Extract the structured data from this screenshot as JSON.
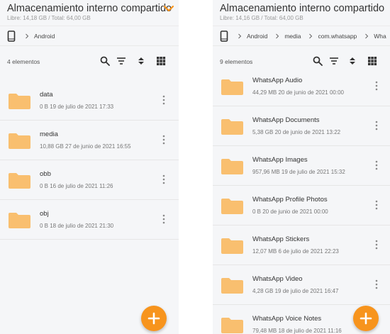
{
  "colors": {
    "accent": "#f7941d",
    "folder": "#f9bf6f",
    "background": "#f5f6f8"
  },
  "left": {
    "title": "Almacenamiento interno compartido",
    "subtitle": "Libre: 14,18 GB / Total: 64,00 GB",
    "breadcrumbs": [
      "Android"
    ],
    "item_count": "4 elementos",
    "items": [
      {
        "name": "data",
        "meta": "0 B 19 de julio de 2021 17:33"
      },
      {
        "name": "media",
        "meta": "10,88 GB 27 de junio de 2021 16:55"
      },
      {
        "name": "obb",
        "meta": "0 B 16 de julio de 2021 11:26"
      },
      {
        "name": "obj",
        "meta": "0 B 18 de julio de 2021 21:30"
      }
    ]
  },
  "right": {
    "title": "Almacenamiento interno compartido",
    "subtitle": "Libre: 14,16 GB / Total: 64,00 GB",
    "breadcrumbs": [
      "Android",
      "media",
      "com.whatsapp",
      "Wha"
    ],
    "item_count": "9 elementos",
    "items": [
      {
        "name": "WhatsApp Audio",
        "meta": "44,29 MB 20 de junio de 2021 00:00"
      },
      {
        "name": "WhatsApp Documents",
        "meta": "5,38 GB 20 de junio de 2021 13:22"
      },
      {
        "name": "WhatsApp Images",
        "meta": "957,96 MB 19 de julio de 2021 15:32"
      },
      {
        "name": "WhatsApp Profile Photos",
        "meta": "0 B 20 de junio de 2021 00:00"
      },
      {
        "name": "WhatsApp Stickers",
        "meta": "12,07 MB 6 de julio de 2021 22:23"
      },
      {
        "name": "WhatsApp Video",
        "meta": "4,28 GB 19 de julio de 2021 16:47"
      },
      {
        "name": "WhatsApp Voice Notes",
        "meta": "79,48 MB 18 de julio de 2021 11:16"
      }
    ]
  }
}
